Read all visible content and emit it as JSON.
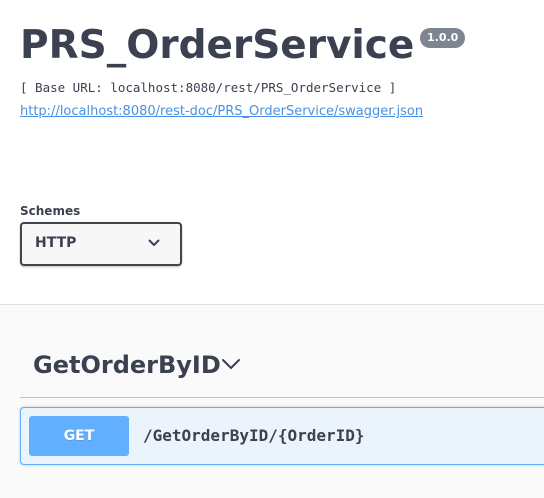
{
  "info": {
    "title": "PRS_OrderService",
    "version": "1.0.0",
    "base_url": "[ Base URL: localhost:8080/rest/PRS_OrderService ]",
    "swagger_link": "http://localhost:8080/rest-doc/PRS_OrderService/swagger.json"
  },
  "schemes": {
    "label": "Schemes",
    "selected": "HTTP",
    "icon": "chevron-down-icon"
  },
  "tag": {
    "name": "GetOrderByID",
    "icon": "chevron-down-icon"
  },
  "operation": {
    "method": "GET",
    "path": "/GetOrderByID/{OrderID}"
  },
  "colors": {
    "text": "#3b4151",
    "link": "#4990e2",
    "version_badge": "#7d8492",
    "get_accent": "#61affe",
    "get_background": "#ebf3fb",
    "ops_background": "#fafafa"
  }
}
